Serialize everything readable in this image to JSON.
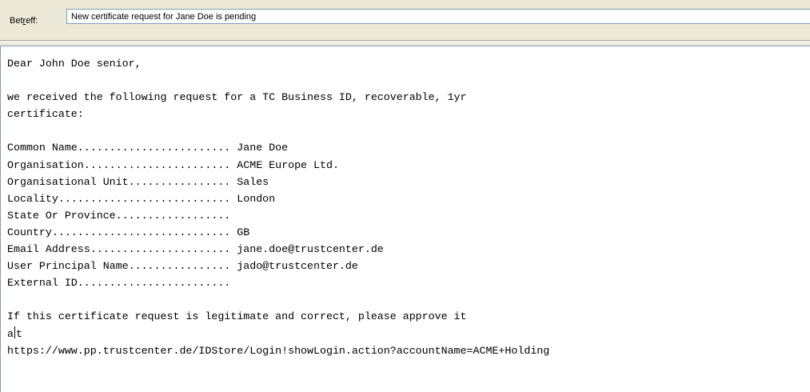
{
  "subject": {
    "label_prefix": "Bet",
    "label_accel": "r",
    "label_suffix": "eff:",
    "value": "New certificate request for Jane Doe is pending"
  },
  "message": {
    "greeting": "Dear John Doe senior,",
    "intro_1": "we received the following request for a TC Business ID, recoverable, 1yr",
    "intro_2": "certificate:",
    "fields": [
      {
        "line": "Common Name........................ Jane Doe"
      },
      {
        "line": "Organisation....................... ACME Europe Ltd."
      },
      {
        "line": "Organisational Unit................ Sales"
      },
      {
        "line": "Locality........................... London"
      },
      {
        "line": "State Or Province.................."
      },
      {
        "line": "Country............................ GB"
      },
      {
        "line": "Email Address...................... jane.doe@trustcenter.de"
      },
      {
        "line": "User Principal Name................ jado@trustcenter.de"
      },
      {
        "line": "External ID........................"
      }
    ],
    "closing_1": "If this certificate request is legitimate and correct, please approve it",
    "closing_2a": "a",
    "closing_2b": "t",
    "link": "https://www.pp.trustcenter.de/IDStore/Login!showLogin.action?accountName=ACME+Holding"
  }
}
